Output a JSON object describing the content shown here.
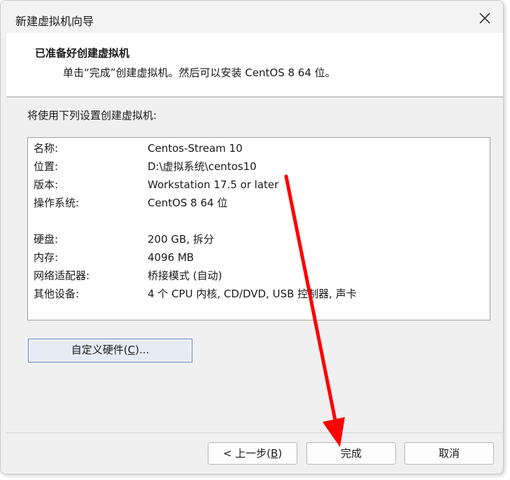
{
  "window": {
    "title": "新建虚拟机向导"
  },
  "header": {
    "title": "已准备好创建虚拟机",
    "subtitle": "单击“完成”创建虚拟机。然后可以安装 CentOS 8 64 位。"
  },
  "intro": "将使用下列设置创建虚拟机:",
  "settings": [
    {
      "key": "名称:",
      "value": "Centos-Stream 10"
    },
    {
      "key": "位置:",
      "value": "D:\\虚拟系统\\centos10"
    },
    {
      "key": "版本:",
      "value": "Workstation 17.5 or later"
    },
    {
      "key": "操作系统:",
      "value": "CentOS 8 64 位"
    },
    {
      "key": "硬盘:",
      "value": "200 GB, 拆分"
    },
    {
      "key": "内存:",
      "value": "4096 MB"
    },
    {
      "key": "网络适配器:",
      "value": "桥接模式 (自动)"
    },
    {
      "key": "其他设备:",
      "value": "4 个 CPU 内核, CD/DVD, USB 控制器, 声卡"
    }
  ],
  "buttons": {
    "customize_prefix": "自定义硬件(",
    "customize_key": "C",
    "customize_suffix": ")...",
    "back_prefix": "< 上一步(",
    "back_key": "B",
    "back_suffix": ")",
    "finish": "完成",
    "cancel": "取消"
  },
  "annotation": {
    "arrow_color": "#ff0000"
  },
  "icons": {
    "close": "close-icon"
  }
}
